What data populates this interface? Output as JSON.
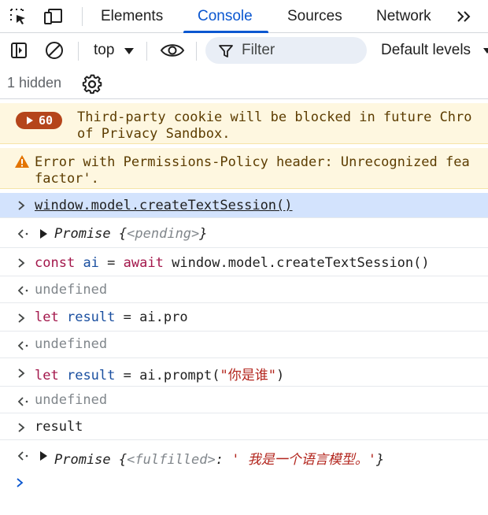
{
  "tabs": [
    {
      "label": "Elements",
      "active": false
    },
    {
      "label": "Console",
      "active": true
    },
    {
      "label": "Sources",
      "active": false
    },
    {
      "label": "Network",
      "active": false
    }
  ],
  "toolbar": {
    "context": "top",
    "filter_placeholder": "Filter",
    "levels": "Default levels"
  },
  "hidden_count_text": "1 hidden",
  "warnings": [
    {
      "count": "60",
      "lines": [
        "Third-party cookie will be blocked in future Chro",
        "of Privacy Sandbox."
      ]
    },
    {
      "lines": [
        "Error with Permissions-Policy header: Unrecognized fea",
        "factor'."
      ]
    }
  ],
  "entries": [
    {
      "kind": "input",
      "text": "window.model.createTextSession()"
    },
    {
      "kind": "output",
      "promise_label": "Promise",
      "open": "{",
      "state": "<pending>",
      "close": "}"
    },
    {
      "kind": "input",
      "kw1": "const",
      "var1": "ai",
      "eq": "=",
      "kw2": "await",
      "rest": "window.model.createTextSession()"
    },
    {
      "kind": "output",
      "text": "undefined"
    },
    {
      "kind": "input",
      "kw1": "let",
      "var1": "result",
      "eq": "=",
      "rest": "ai.pro"
    },
    {
      "kind": "output",
      "text": "undefined"
    },
    {
      "kind": "input",
      "kw1": "let",
      "var1": "result",
      "eq": "=",
      "rest_pre": "ai.prompt(",
      "str": "\"你是谁\"",
      "rest_post": ")"
    },
    {
      "kind": "output",
      "text": "undefined"
    },
    {
      "kind": "input",
      "text": "result"
    },
    {
      "kind": "output",
      "promise_label": "Promise",
      "open": "{",
      "state": "<fulfilled>",
      "colon": ":",
      "value": "' 我是一个语言模型。'",
      "close": "}"
    }
  ],
  "colors": {
    "accent": "#0b57d0",
    "warning_bg": "#fef7e0",
    "badge": "#b5451b",
    "keyword": "#a3174b",
    "string": "#b3261e",
    "selected_row": "#d3e3fd"
  },
  "icons": [
    "inspect-element-icon",
    "device-toolbar-icon",
    "more-tabs-icon",
    "sidebar-toggle-icon",
    "clear-console-icon",
    "eye-icon",
    "filter-icon",
    "gear-icon",
    "warning-icon",
    "prompt-chevron-icon",
    "result-arrow-icon"
  ]
}
